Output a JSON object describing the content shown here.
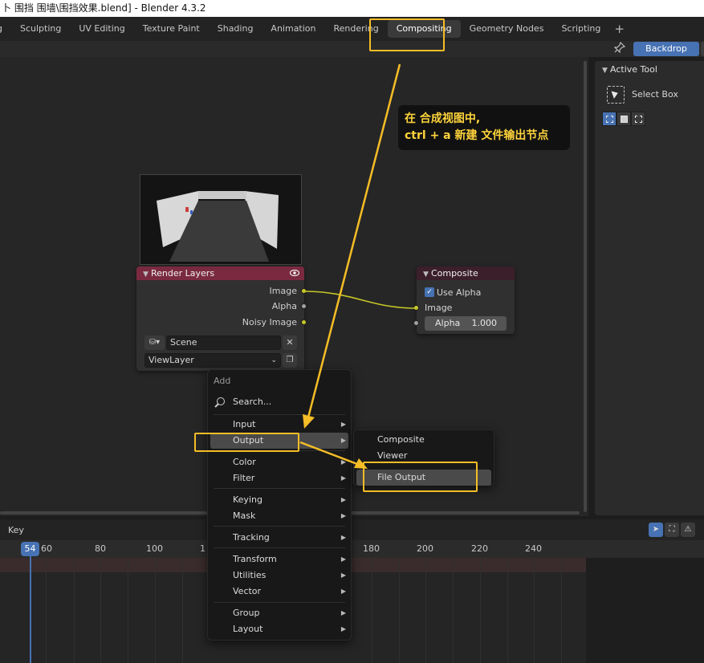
{
  "window": {
    "title": "卜 围挡 围墙\\围挡效果.blend] - Blender 4.3.2"
  },
  "workspaces": {
    "tabs": [
      {
        "label": "g"
      },
      {
        "label": "Sculpting"
      },
      {
        "label": "UV Editing"
      },
      {
        "label": "Texture Paint"
      },
      {
        "label": "Shading"
      },
      {
        "label": "Animation"
      },
      {
        "label": "Rendering"
      },
      {
        "label": "Compositing"
      },
      {
        "label": "Geometry Nodes"
      },
      {
        "label": "Scripting"
      }
    ],
    "active": "Compositing",
    "add_label": "+"
  },
  "header": {
    "backdrop_label": "Backdrop",
    "pin_icon": "pin-icon"
  },
  "sidebar": {
    "panel_title": "Active Tool",
    "tool_label": "Select Box"
  },
  "annotation": {
    "line1": "在 合成视图中,",
    "line2": "ctrl + a 新建 文件输出节点",
    "color": "#f5bd26"
  },
  "render_layers_node": {
    "title": "Render Layers",
    "outputs": [
      "Image",
      "Alpha",
      "Noisy Image"
    ],
    "scene_value": "Scene",
    "view_layer_value": "ViewLayer",
    "header_color": "#7a2a40"
  },
  "composite_node": {
    "title": "Composite",
    "use_alpha_label": "Use Alpha",
    "use_alpha_checked": true,
    "input_image_label": "Image",
    "alpha_label": "Alpha",
    "alpha_value": "1.000"
  },
  "add_menu": {
    "title": "Add",
    "search_label": "Search...",
    "items": [
      {
        "label": "Input"
      },
      {
        "label": "Output"
      },
      {
        "label": "Color"
      },
      {
        "label": "Filter"
      },
      {
        "label": "Keying"
      },
      {
        "label": "Mask"
      },
      {
        "label": "Tracking"
      },
      {
        "label": "Transform"
      },
      {
        "label": "Utilities"
      },
      {
        "label": "Vector"
      },
      {
        "label": "Group"
      },
      {
        "label": "Layout"
      }
    ],
    "selected": "Output"
  },
  "output_submenu": {
    "items": [
      {
        "label": "Composite"
      },
      {
        "label": "Viewer"
      },
      {
        "label": "File Output"
      }
    ],
    "selected": "File Output"
  },
  "timeline": {
    "key_label": "Key",
    "current_frame": "54",
    "ticks": [
      "60",
      "80",
      "100",
      "1",
      "180",
      "200",
      "220",
      "240"
    ]
  },
  "colors": {
    "accent": "#4772b3",
    "socket_yellow": "#c7c729",
    "socket_gray": "#a1a1a1"
  }
}
